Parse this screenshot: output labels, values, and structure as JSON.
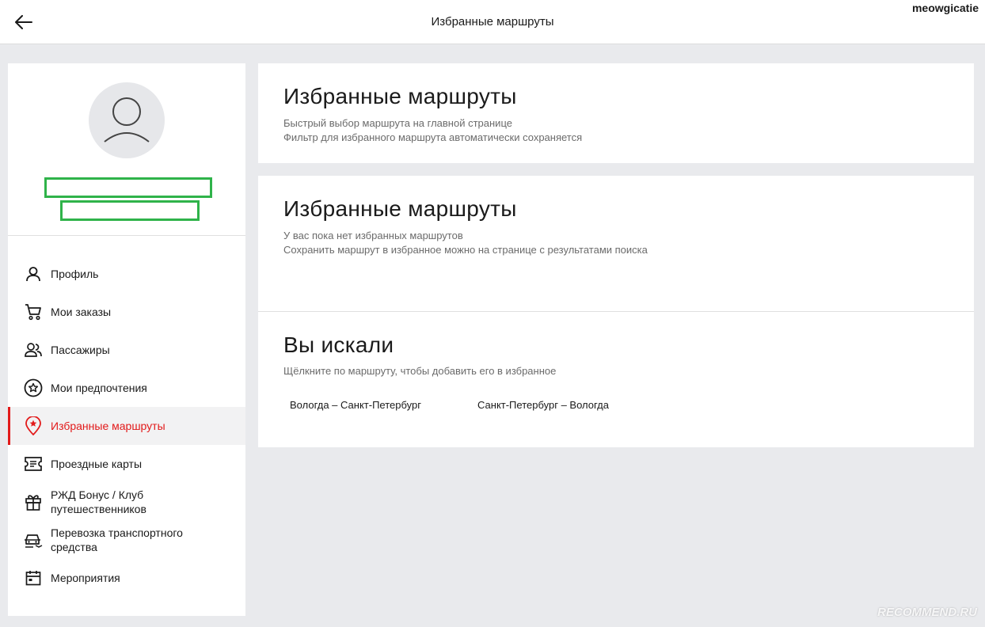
{
  "header": {
    "title": "Избранные маршруты",
    "username": "meowgicatie"
  },
  "sidebar": {
    "items": [
      {
        "label": "Профиль",
        "icon": "user-icon"
      },
      {
        "label": "Мои заказы",
        "icon": "cart-icon"
      },
      {
        "label": "Пассажиры",
        "icon": "passengers-icon"
      },
      {
        "label": "Мои предпочтения",
        "icon": "star-circle-icon"
      },
      {
        "label": "Избранные маршруты",
        "icon": "location-star-icon",
        "active": true
      },
      {
        "label": "Проездные карты",
        "icon": "ticket-icon"
      },
      {
        "label": "РЖД Бонус / Клуб путешественников",
        "icon": "gift-icon"
      },
      {
        "label": "Перевозка транспортного средства",
        "icon": "car-transport-icon"
      },
      {
        "label": "Мероприятия",
        "icon": "calendar-icon"
      }
    ]
  },
  "card1": {
    "title": "Избранные маршруты",
    "line1": "Быстрый выбор маршрута на главной странице",
    "line2": "Фильтр для избранного маршрута автоматически сохраняется"
  },
  "card2": {
    "title": "Избранные маршруты",
    "line1": "У вас пока нет избранных маршрутов",
    "line2": "Сохранить маршрут в избранное можно на странице с результатами поиска"
  },
  "searched": {
    "title": "Вы искали",
    "hint": "Щёлкните по маршруту, чтобы добавить его в избранное",
    "routes": [
      "Вологда – Санкт-Петербург",
      "Санкт-Петербург – Вологда"
    ]
  },
  "watermark": "RECOMMEND.RU",
  "colors": {
    "accent": "#e21a1a",
    "highlight_box": "#2fb34a"
  }
}
